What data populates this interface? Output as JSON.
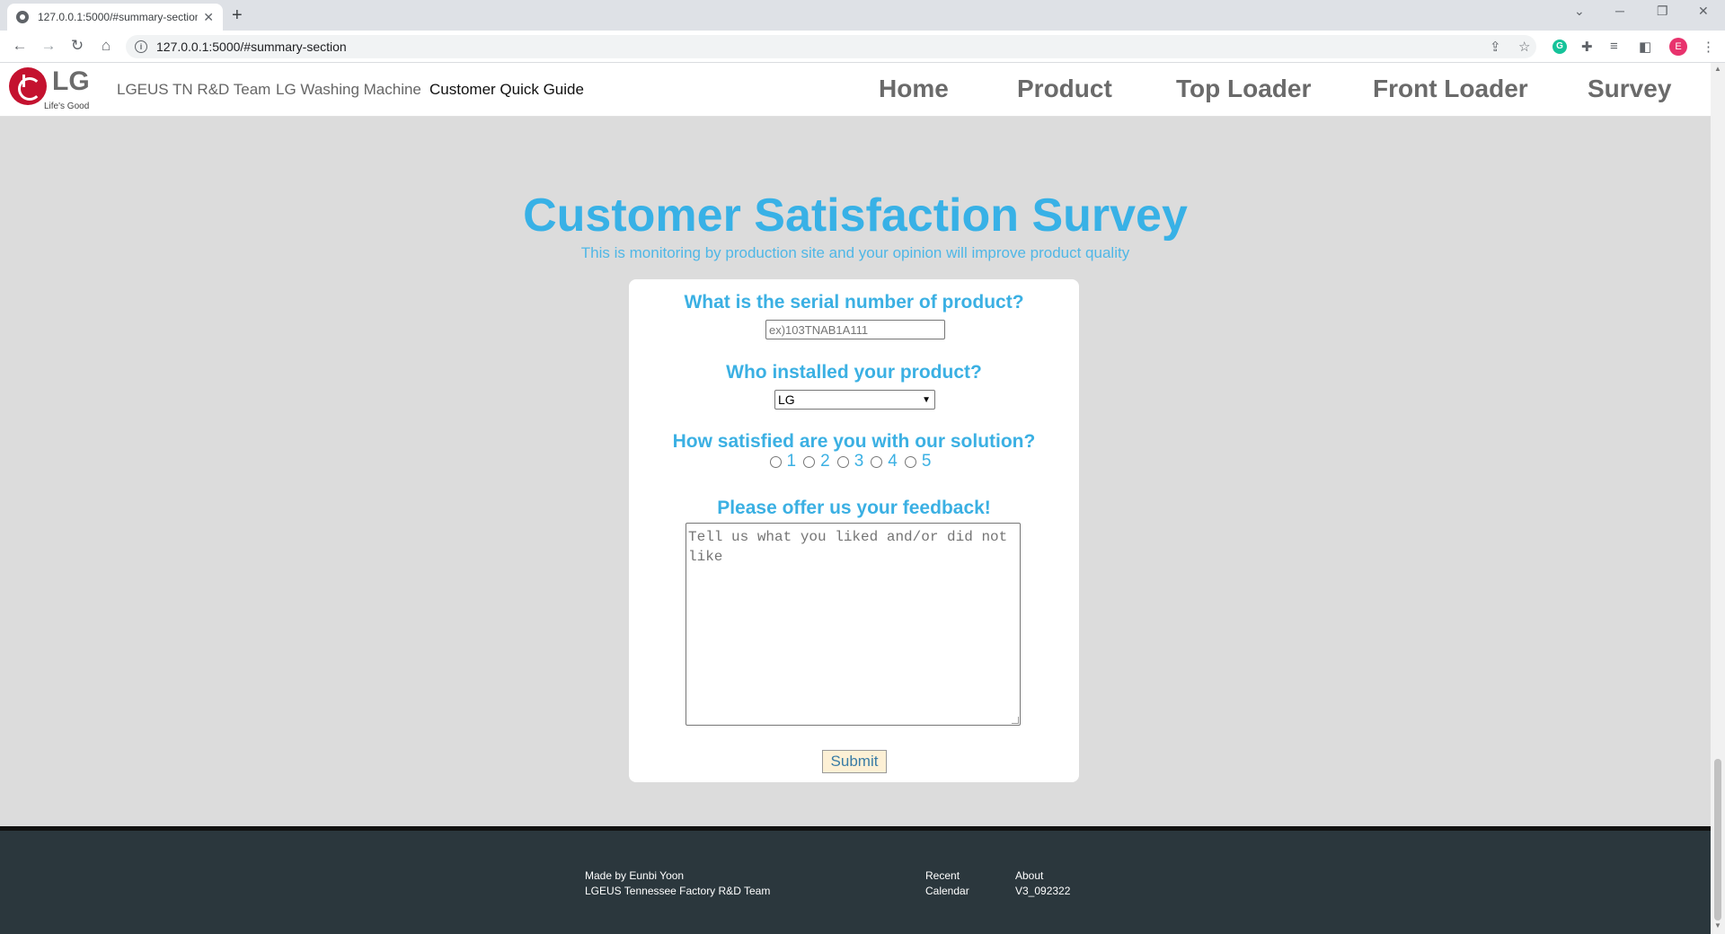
{
  "browser": {
    "tab_title": "127.0.0.1:5000/#summary-section",
    "url": "127.0.0.1:5000/#summary-section",
    "profile_initial": "E"
  },
  "site": {
    "logo_text": "LG",
    "logo_tagline": "Life's Good",
    "nav_small": [
      "LGEUS TN R&D Team",
      "LG Washing Machine",
      "Customer Quick Guide"
    ],
    "nav_big": [
      "Home",
      "Product",
      "Top Loader",
      "Front Loader",
      "Survey"
    ]
  },
  "survey": {
    "title": "Customer Satisfaction Survey",
    "subtitle": "This is monitoring by production site and your opinion will improve product quality",
    "q_serial": "What is the serial number of product?",
    "serial_placeholder": "ex)103TNAB1A111",
    "q_installer": "Who installed your product?",
    "installer_selected": "LG",
    "q_satisfaction": "How satisfied are you with our solution?",
    "ratings": [
      "1",
      "2",
      "3",
      "4",
      "5"
    ],
    "q_feedback": "Please offer us your feedback!",
    "feedback_placeholder": "Tell us what you liked and/or did not like",
    "submit_label": "Submit"
  },
  "footer": {
    "made_by": "Made by Eunbi Yoon",
    "org": "LGEUS Tennessee Factory R&D Team",
    "recent": "Recent",
    "calendar": "Calendar",
    "about": "About",
    "version": "V3_092322"
  },
  "colors": {
    "accent": "#38b1e6",
    "footer_bg": "#2b373d",
    "page_bg": "#dcdcdc",
    "submit_bg": "#fdf0d5",
    "brand_red": "#c4122f"
  }
}
